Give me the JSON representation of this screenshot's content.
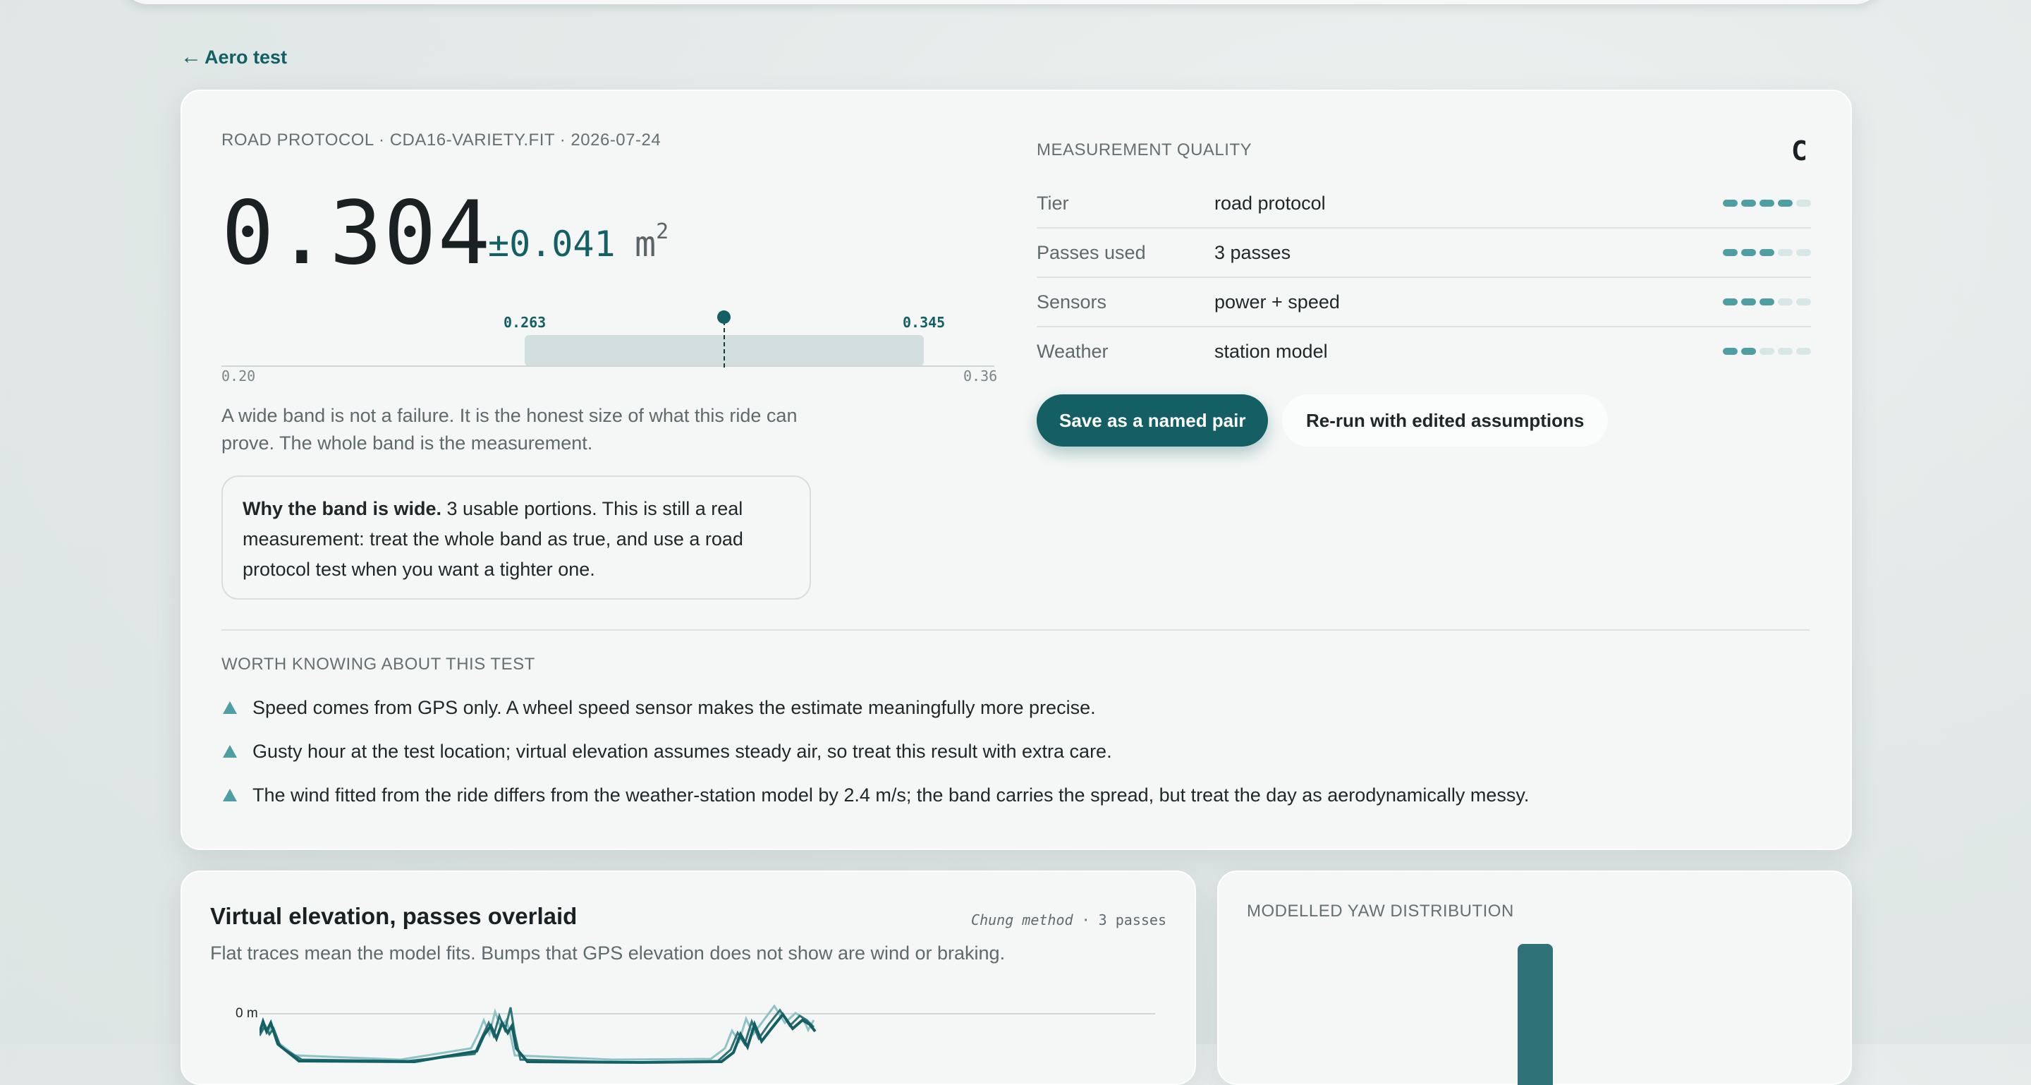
{
  "nav": {
    "back_label": "Aero test"
  },
  "result": {
    "context": "ROAD PROTOCOL · CDA16-VARIETY.FIT · 2026-07-24",
    "value": "0.304",
    "uncertainty": "±0.041",
    "unit": "m",
    "unit_power": "2",
    "band": {
      "low_label": "0.263",
      "high_label": "0.345",
      "axis_min": "0.20",
      "axis_max": "0.36"
    },
    "explanation": "A wide band is not a failure. It is the honest size of what this ride can prove. The whole band is the measurement.",
    "note_heading": "Why the band is wide.",
    "note_body": " 3 usable portions. This is still a real measurement: treat the whole band as true, and use a road protocol test when you want a tighter one."
  },
  "quality": {
    "title": "MEASUREMENT QUALITY",
    "grade": "C",
    "rows": [
      {
        "label": "Tier",
        "value": "road protocol",
        "level": 4,
        "max": 5
      },
      {
        "label": "Passes used",
        "value": "3 passes",
        "level": 3,
        "max": 5
      },
      {
        "label": "Sensors",
        "value": "power + speed",
        "level": 3,
        "max": 5
      },
      {
        "label": "Weather",
        "value": "station model",
        "level": 2,
        "max": 5
      }
    ]
  },
  "actions": {
    "save_label": "Save as a named pair",
    "rerun_label": "Re-run with edited assumptions"
  },
  "worth_knowing": {
    "title": "WORTH KNOWING ABOUT THIS TEST",
    "items": [
      "Speed comes from GPS only. A wheel speed sensor makes the estimate meaningfully more precise.",
      "Gusty hour at the test location; virtual elevation assumes steady air, so treat this result with extra care.",
      "The wind fitted from the ride differs from the weather-station model by 2.4 m/s; the band carries the spread, but treat the day as aerodynamically messy."
    ]
  },
  "virtual_elevation": {
    "title": "Virtual elevation, passes overlaid",
    "method": "Chung method",
    "passes": "3 passes",
    "subtitle": "Flat traces mean the model fits. Bumps that GPS elevation does not show are wind or braking.",
    "zero_label": "0 m"
  },
  "yaw": {
    "title": "MODELLED YAW DISTRIBUTION"
  },
  "colors": {
    "accent": "#135f63",
    "accent_light": "#4f9ea3",
    "band": "#d2dfde",
    "card": "#f5f7f6"
  }
}
